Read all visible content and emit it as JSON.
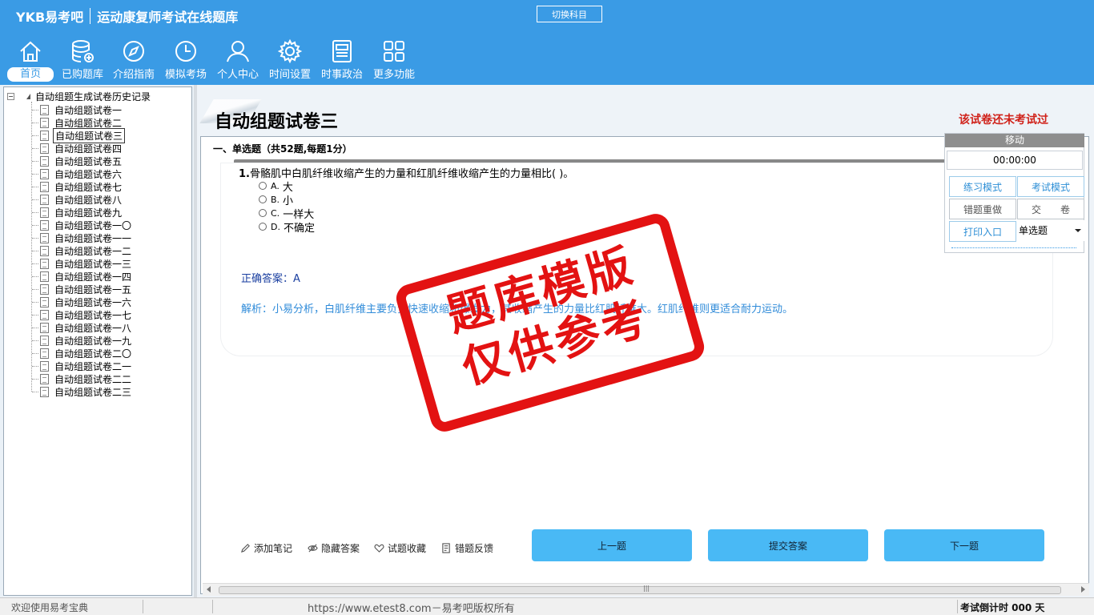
{
  "header": {
    "logo": "YKB易考吧",
    "subtitle": "运动康复师考试在线题库",
    "switch_subject": "切换科目"
  },
  "nav": {
    "items": [
      {
        "label": "首页",
        "icon": "home-icon"
      },
      {
        "label": "已购题库",
        "icon": "database-icon"
      },
      {
        "label": "介绍指南",
        "icon": "compass-icon"
      },
      {
        "label": "模拟考场",
        "icon": "clock-icon"
      },
      {
        "label": "个人中心",
        "icon": "user-icon"
      },
      {
        "label": "时间设置",
        "icon": "gear-icon"
      },
      {
        "label": "时事政治",
        "icon": "newspaper-icon"
      },
      {
        "label": "更多功能",
        "icon": "grid-icon"
      }
    ]
  },
  "tree": {
    "root": "自动组题生成试卷历史记录",
    "items": [
      "自动组题试卷一",
      "自动组题试卷二",
      "自动组题试卷三",
      "自动组题试卷四",
      "自动组题试卷五",
      "自动组题试卷六",
      "自动组题试卷七",
      "自动组题试卷八",
      "自动组题试卷九",
      "自动组题试卷一〇",
      "自动组题试卷一一",
      "自动组题试卷一二",
      "自动组题试卷一三",
      "自动组题试卷一四",
      "自动组题试卷一五",
      "自动组题试卷一六",
      "自动组题试卷一七",
      "自动组题试卷一八",
      "自动组题试卷一九",
      "自动组题试卷二〇",
      "自动组题试卷二一",
      "自动组题试卷二二",
      "自动组题试卷二三"
    ],
    "selected_index": 2
  },
  "paper": {
    "title": "自动组题试卷三",
    "status": "该试卷还未考试过",
    "section": "一、单选题（共52题,每题1分）"
  },
  "question": {
    "number": "1.",
    "text": "骨骼肌中白肌纤维收缩产生的力量和红肌纤维收缩产生的力量相比(  )。",
    "options": [
      {
        "key": "A.",
        "text": "大"
      },
      {
        "key": "B.",
        "text": "小"
      },
      {
        "key": "C.",
        "text": "一样大"
      },
      {
        "key": "D.",
        "text": "不确定"
      }
    ],
    "answer": "正确答案：A",
    "analysis": "解析：小易分析，白肌纤维主要负责快速收缩和爆发力，其收缩产生的力量比红肌纤维大。红肌纤维则更适合耐力运动。"
  },
  "watermark": {
    "line1": "题库模版",
    "line2": "仅供参考"
  },
  "tools": [
    {
      "label": "添加笔记",
      "icon": "pencil-icon"
    },
    {
      "label": "隐藏答案",
      "icon": "eye-icon"
    },
    {
      "label": "试题收藏",
      "icon": "heart-icon"
    },
    {
      "label": "错题反馈",
      "icon": "feedback-icon"
    }
  ],
  "buttons": {
    "prev": "上一题",
    "submit": "提交答案",
    "next": "下一题"
  },
  "side_panel": {
    "move": "移动",
    "timer": "00:00:00",
    "practice": "练习模式",
    "exam": "考试模式",
    "redo_wrong": "错题重做",
    "hand_in": "交　　卷",
    "print": "打印入口",
    "question_type": "单选题"
  },
  "status_bar": {
    "welcome": "欢迎使用易考宝典",
    "url": "https://www.etest8.com－易考吧版权所有",
    "countdown": "考试倒计时 000 天"
  },
  "colors": {
    "header_blue": "#3a9be5",
    "button_blue": "#49b9f5",
    "stamp_red": "#e31212",
    "status_red": "#d0221a"
  }
}
